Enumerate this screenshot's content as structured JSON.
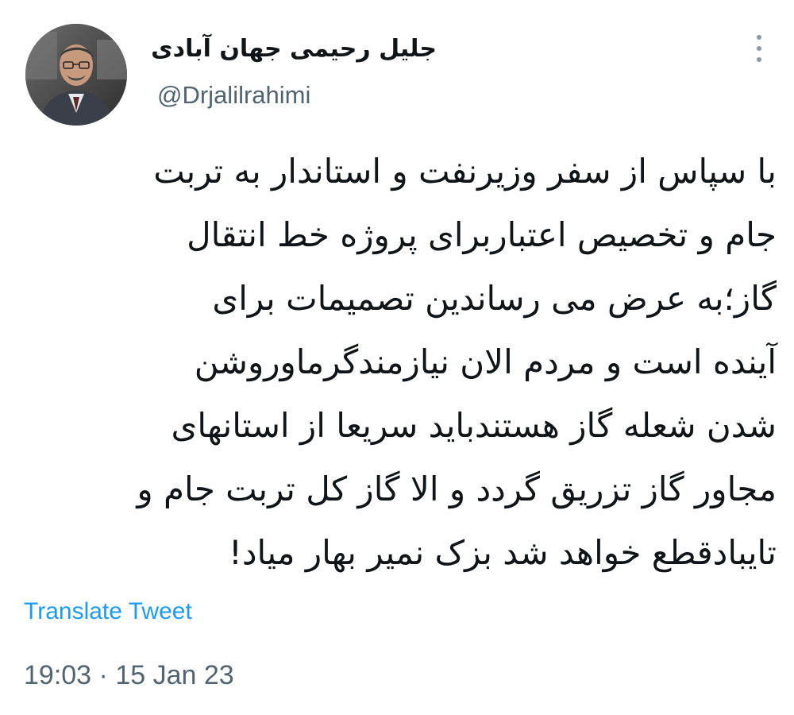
{
  "author": {
    "display_name": "جلیل رحیمی جهان آبادی",
    "handle": "@Drjalilrahimi",
    "avatar_icon": "profile-photo"
  },
  "tweet": {
    "lines": [
      "با سپاس از سفر وزیرنفت و استاندار به تربت",
      "جام و تخصیص اعتباربرای پروژه خط انتقال",
      "گاز؛به عرض می رساندین تصمیمات برای",
      "آینده است و مردم الان نیازمندگرماوروشن",
      "شدن شعله گاز هستندباید سریعا از استانهای",
      "مجاور گاز تزریق گردد و الا گاز کل تربت جام و",
      "تایبادقطع خواهد شد بزک نمیر بهار میاد!"
    ]
  },
  "translate_label": "Translate Tweet",
  "timestamp": {
    "time": "19:03",
    "separator": "·",
    "date": "15 Jan 23"
  },
  "colors": {
    "text": "#0f1419",
    "secondary": "#536471",
    "link": "#1d9bf0",
    "icon": "#8b98a5"
  },
  "icons": {
    "more": "more-vertical-icon"
  }
}
